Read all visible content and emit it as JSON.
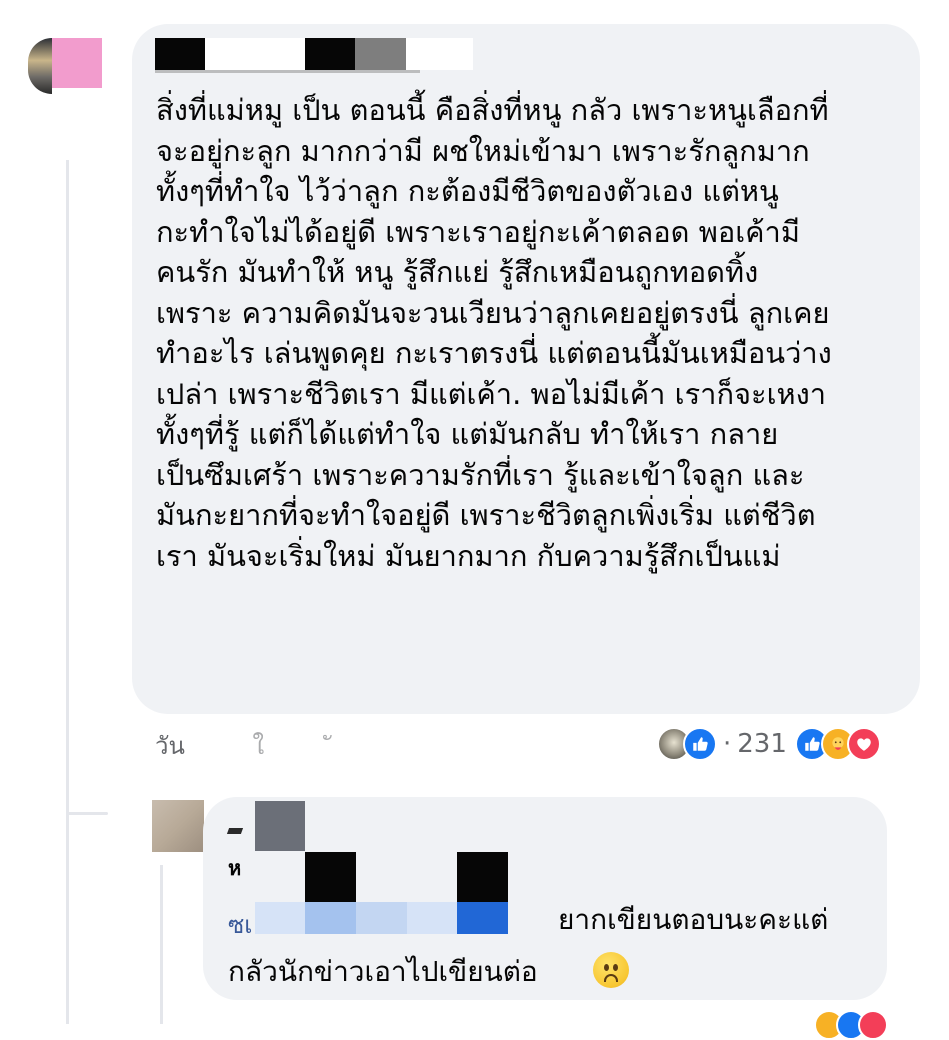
{
  "comment": {
    "text": "สิ่งที่แม่หมู เป็น ตอนนี้  คือสิ่งที่หนู กลัว เพราะหนูเลือกที่\nจะอยู่กะลูก มากกว่ามี ผชใหม่เข้ามา เพราะรักลูกมาก\nทั้งๆที่ทำใจ ไว้ว่าลูก กะต้องมีชีวิตของตัวเอง  แต่หนู\nกะทำใจไม่ได้อยู่ดี  เพราะเราอยู่กะเค้าตลอด พอเค้ามี\nคนรัก มันทำให้ หนู รู้สึกแย่  รู้สึกเหมือนถูกทอดทิ้ง\nเพราะ ความคิดมันจะวนเวียนว่าลูกเคยอยู่ตรงนี่  ลูกเคย\nทำอะไร เล่นพูดคุย  กะเราตรงนี่ แต่ตอนนี้มันเหมือนว่าง\nเปล่า เพราะชีวิตเรา มีแต่เค้า. พอไม่มีเค้า เราก็จะเหงา\nทั้งๆที่รู้  แต่ก็ได้แต่ทำใจ แต่มันกลับ ทำให้เรา กลาย\nเป็นซึมเศร้า  เพราะความรักที่เรา รู้และเข้าใจลูก  และ\nมันกะยากที่จะทำใจอยู่ดี  เพราะชีวิตลูกเพิ่งเริ่ม  แต่ชีวิต\nเรา มันจะเริ่มใหม่ มันยากมาก กับความรู้สึกเป็นแม่",
    "meta_time": "วัน",
    "reaction_count": "231",
    "separator": "·"
  },
  "reply": {
    "text_line1": "ยากเขียนตอบนะคะแต่",
    "text_line2": "กลัวนักข่าวเอาไปเขียนต่อ",
    "mention_fragment": "ซเ",
    "name_fragment": "ห"
  },
  "icons": {
    "like": "like-icon",
    "care": "care-icon",
    "love": "love-icon",
    "sad_emoji": "sad-face-emoji"
  },
  "colors": {
    "bubble": "#f0f2f5",
    "like_blue": "#1877f2",
    "love_red": "#f33e58",
    "care_yellow": "#f7b125",
    "meta_gray": "#65676b"
  }
}
